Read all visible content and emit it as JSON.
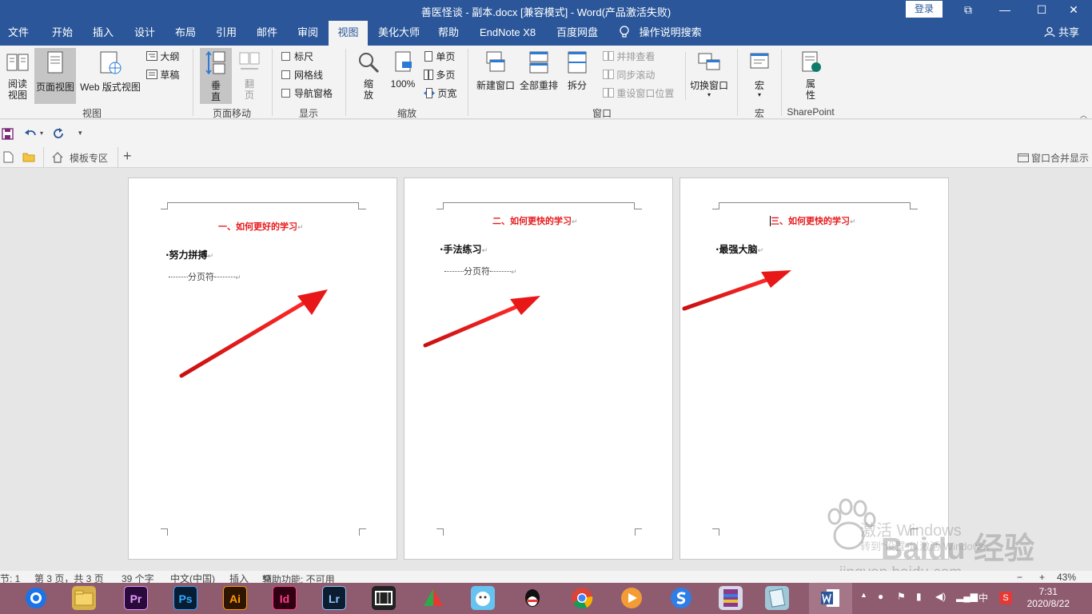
{
  "window": {
    "title": "善医怪谈 - 副本.docx [兼容模式]  -  Word(产品激活失败)",
    "login_label": "登录",
    "minimize": "—",
    "maximize": "☐",
    "close": "✕",
    "restore": "⧉"
  },
  "tabs": [
    "文件",
    "开始",
    "插入",
    "设计",
    "布局",
    "引用",
    "邮件",
    "审阅",
    "视图",
    "美化大师",
    "帮助",
    "EndNote X8",
    "百度网盘"
  ],
  "active_tab": "视图",
  "tell_me": "操作说明搜索",
  "share_label": "共享",
  "ribbon": {
    "views": {
      "group": "视图",
      "read_mode": "阅读\n视图",
      "print_layout": "页面视图",
      "web_layout": "Web 版式视图",
      "outline": "大纲",
      "draft": "草稿"
    },
    "page_movement": {
      "group": "页面移动",
      "vertical": "垂\n直",
      "side_to_side": "翻\n页"
    },
    "show": {
      "group": "显示",
      "ruler": "标尺",
      "gridlines": "网格线",
      "nav_pane": "导航窗格"
    },
    "zoom": {
      "group": "缩放",
      "zoom": "缩\n放",
      "hundred": "100%",
      "one_page": "单页",
      "multiple_pages": "多页",
      "page_width": "页宽"
    },
    "window": {
      "group": "窗口",
      "new_window": "新建窗口",
      "arrange_all": "全部重排",
      "split": "拆分",
      "side_by_side": "并排查看",
      "sync_scroll": "同步滚动",
      "reset_position": "重设窗口位置",
      "switch_windows": "切换窗口"
    },
    "macros": {
      "group": "宏",
      "macros": "宏"
    },
    "sharepoint": {
      "group": "SharePoint",
      "properties": "属\n性"
    }
  },
  "doc_tabs": {
    "template_zone": "模板专区",
    "add": "+",
    "merge_windows": "窗口合并显示"
  },
  "pages": [
    {
      "heading": "一、如何更好的学习",
      "bullet": "·努力拼搏",
      "page_break": "分页符"
    },
    {
      "heading": "二、如何更快的学习",
      "bullet": "·手法练习",
      "page_break": "分页符"
    },
    {
      "heading": "三、如何更快的学习",
      "bullet": "·最强大脑",
      "page_break": ""
    }
  ],
  "status": {
    "section": "节: 1",
    "page": "第 3 页，共 3 页",
    "words": "39 个字",
    "lang": "中文(中国)",
    "mode": "插入",
    "accessibility": "辅助功能: 不可用",
    "zoom_minus": "−",
    "zoom_plus": "+",
    "zoom": "43%"
  },
  "watermark": {
    "activate": "激活 Windows",
    "activate_sub": "转到\"设置\"以激活 Windows。",
    "baidu": "Baidu 经验",
    "url": "jingyan.baidu.com"
  },
  "taskbar": {
    "apps": [
      "Pr",
      "Ps",
      "Ai",
      "Id",
      "Lr"
    ],
    "ime_zh": "中",
    "time": "7:31",
    "date": "2020/8/22"
  },
  "colors": {
    "accent": "#2b579a",
    "heading_red": "#e8191b",
    "taskbar": "#8f5b6f"
  }
}
